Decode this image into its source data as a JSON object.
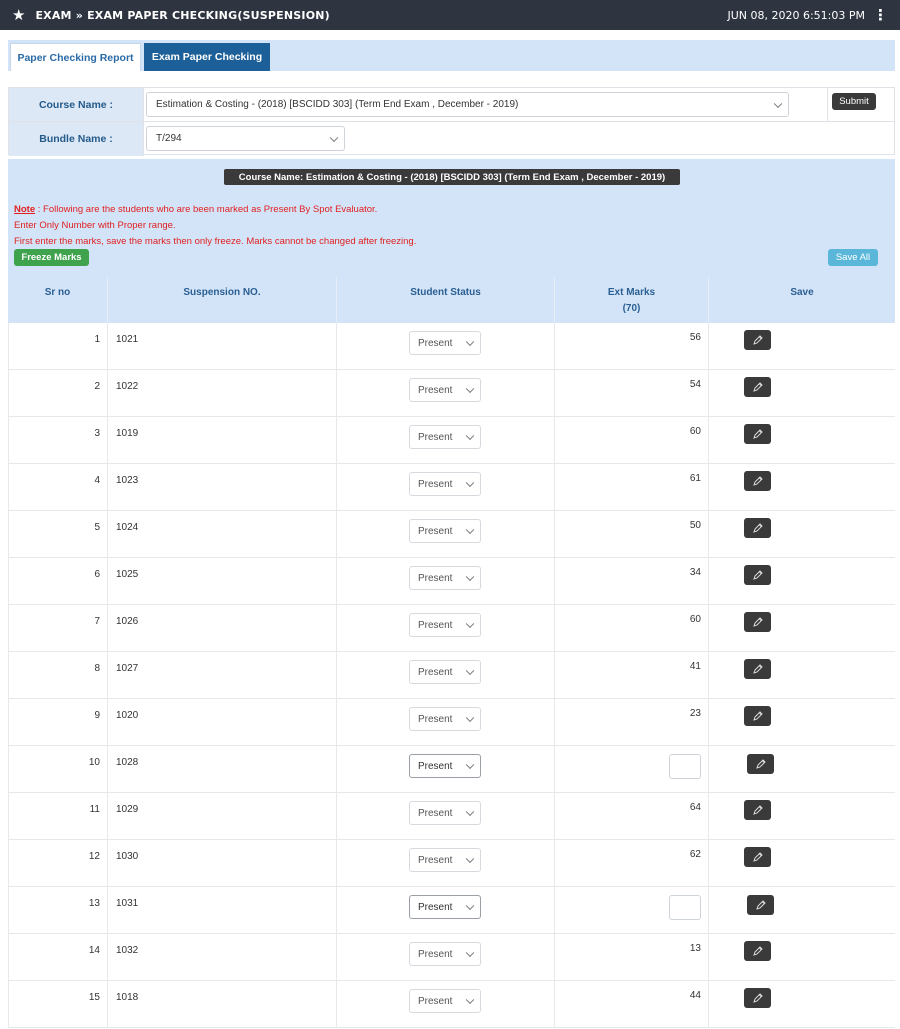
{
  "topbar": {
    "breadcrumb": "EXAM » EXAM PAPER CHECKING(SUSPENSION)",
    "datetime": "JUN 08, 2020  6:51:03 PM"
  },
  "tabs": [
    {
      "label": "Paper Checking Report"
    },
    {
      "label": "Exam Paper Checking"
    }
  ],
  "form": {
    "course_label": "Course Name :",
    "course_value": "Estimation & Costing - (2018) [BSCIDD 303] (Term End Exam , December - 2019)",
    "bundle_label": "Bundle Name :",
    "bundle_value": "T/294",
    "submit_label": "Submit"
  },
  "panel": {
    "course_banner": "Course Name: Estimation & Costing - (2018) [BSCIDD 303] (Term End Exam , December - 2019)",
    "note_label": "Note",
    "note_text": " : Following are the students who are been marked as Present By Spot Evaluator.",
    "line2": "Enter Only Number with Proper range.",
    "line3": "First enter the marks, save the marks then only freeze. Marks cannot be changed after freezing.",
    "freeze_label": "Freeze Marks",
    "save_all_label": "Save All"
  },
  "table": {
    "headers": {
      "sr": "Sr no",
      "suspension": "Suspension NO.",
      "status": "Student Status",
      "marks": "Ext Marks",
      "marks_max": "(70)",
      "save": "Save"
    },
    "rows": [
      {
        "sr": "1",
        "suspension": "1021",
        "status": "Present",
        "marks": "56"
      },
      {
        "sr": "2",
        "suspension": "1022",
        "status": "Present",
        "marks": "54"
      },
      {
        "sr": "3",
        "suspension": "1019",
        "status": "Present",
        "marks": "60"
      },
      {
        "sr": "4",
        "suspension": "1023",
        "status": "Present",
        "marks": "61"
      },
      {
        "sr": "5",
        "suspension": "1024",
        "status": "Present",
        "marks": "50"
      },
      {
        "sr": "6",
        "suspension": "1025",
        "status": "Present",
        "marks": "34"
      },
      {
        "sr": "7",
        "suspension": "1026",
        "status": "Present",
        "marks": "60"
      },
      {
        "sr": "8",
        "suspension": "1027",
        "status": "Present",
        "marks": "41"
      },
      {
        "sr": "9",
        "suspension": "1020",
        "status": "Present",
        "marks": "23"
      },
      {
        "sr": "10",
        "suspension": "1028",
        "status": "Present",
        "marks": ""
      },
      {
        "sr": "11",
        "suspension": "1029",
        "status": "Present",
        "marks": "64"
      },
      {
        "sr": "12",
        "suspension": "1030",
        "status": "Present",
        "marks": "62"
      },
      {
        "sr": "13",
        "suspension": "1031",
        "status": "Present",
        "marks": ""
      },
      {
        "sr": "14",
        "suspension": "1032",
        "status": "Present",
        "marks": "13"
      },
      {
        "sr": "15",
        "suspension": "1018",
        "status": "Present",
        "marks": "44"
      }
    ]
  },
  "colors": {
    "topbar": "#2e3440",
    "header_bg": "#d3e4f8",
    "accent": "#1d5f98",
    "note_red": "#e02020",
    "freeze_green": "#3fa34d",
    "save_all_blue": "#5bb7d9"
  }
}
